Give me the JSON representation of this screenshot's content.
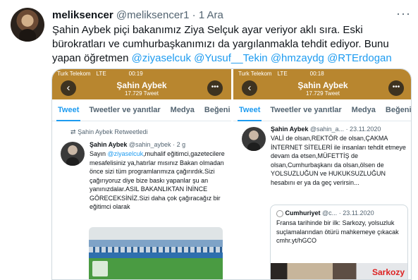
{
  "tweet": {
    "display_name": "meliksencer",
    "handle": "@meliksencer1",
    "separator": "·",
    "date": "1 Ara",
    "text": {
      "before": "Şahin Aybek piçi bakanımız Ziya Selçuk ayar veriyor aklı sıra. Eski bürokratları ve cumhurbaşkanımızı da yargılanmakla tehdit ediyor. Bunu yapan öğretmen ",
      "mentions": [
        "@ziyaselcuk",
        "@Yusuf__Tekin",
        "@hmzaydg",
        "@RTErdogan"
      ]
    },
    "more_label": "···"
  },
  "left_panel": {
    "status_bar": {
      "carrier": "Turk Telekom",
      "network": "LTE",
      "time": "00:19"
    },
    "profile": {
      "name": "Şahin Aybek",
      "tweet_count": "17.729 Tweet"
    },
    "tabs": [
      "Tweet",
      "Tweetler ve yanıtlar",
      "Medya",
      "Beğeni"
    ],
    "retweeted_label": "Şahin Aybek Retweetledi",
    "post": {
      "name": "Şahin Aybek",
      "handle": "@sahin_aybek",
      "date": "· 2 g",
      "greeting": "Sayın ",
      "mention": "@ziyaselcuk",
      "text": ",muhalif eğitimci,gazetecilere mesafelisiniz ya,hatırlar mısınız Bakan olmadan önce sizi tüm programlarımıza çağırırdık.Sizi çağırıyoruz diye bize baskı yapanlar şu an yanınızdalar.ASIL BAKANLIKTAN İNİNCE GÖRECEKSİNİZ.Sizi daha çok çağıracağız bir eğitimci olarak"
    }
  },
  "right_panel": {
    "status_bar": {
      "carrier": "Turk Telekom",
      "network": "LTE",
      "time": "00:18"
    },
    "profile": {
      "name": "Şahin Aybek",
      "tweet_count": "17.729 Tweet"
    },
    "tabs": [
      "Tweet",
      "Tweetler ve yanıtlar",
      "Medya",
      "Beğeni"
    ],
    "post": {
      "name": "Şahin Aybek",
      "handle": "@sahin_a...",
      "date": "· 23.11.2020",
      "text": "VALİ de olsan,REKTÖR de olsan,ÇAKMA İNTERNET SİTELERİ ile insanları tehdit etmeye devam da etsen,MÜFETTİŞ de olsan,Cumhurbaşkanı da olsan,ölsen de YOLSUZLUĞUN ve HUKUKSUZLUĞUN hesabını er ya da geç verirsin..."
    },
    "quote": {
      "name": "Cumhuriyet",
      "handle": "@c...",
      "date": "· 23.11.2020",
      "text": "Fransa tarihinde bir ilk: Sarkozy, yolsuzluk suçlamalarından ötürü mahkemeye çıkacak cmhr.yt/hGCO"
    }
  }
}
